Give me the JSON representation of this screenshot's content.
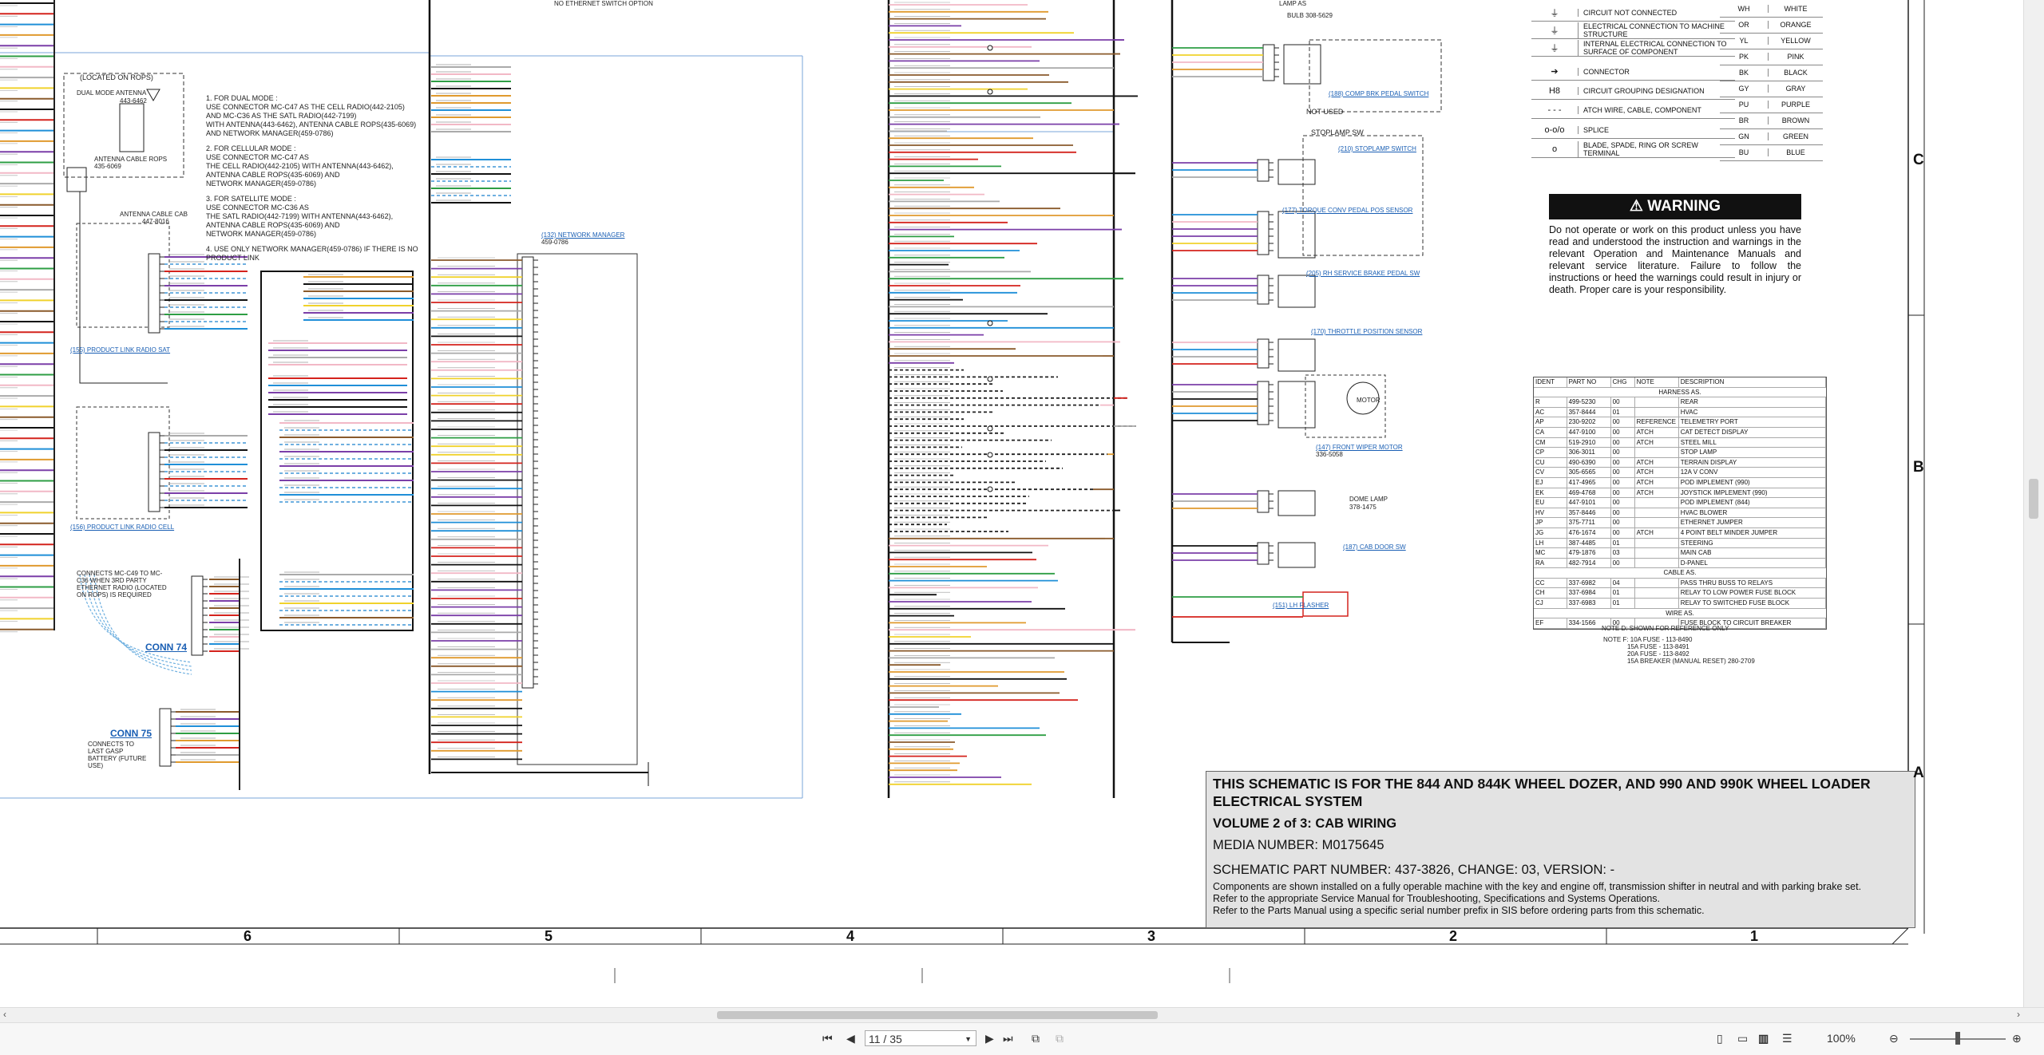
{
  "schematic": {
    "general_notes": [
      "1. FOR DUAL MODE :",
      "USE CONNECTOR MC-C47 AS THE CELL RADIO(442-2105)",
      "AND MC-C36 AS THE SATL RADIO(442-7199)",
      "WITH ANTENNA(443-6462), ANTENNA CABLE ROPS(435-6069)",
      "AND NETWORK MANAGER(459-0786)",
      "2. FOR CELLULAR MODE :",
      "USE CONNECTOR MC-C47 AS",
      "THE CELL RADIO(442-2105) WITH ANTENNA(443-6462),",
      "ANTENNA CABLE ROPS(435-6069) AND",
      "NETWORK MANAGER(459-0786)",
      "3. FOR SATELLITE MODE :",
      "USE CONNECTOR MC-C36 AS",
      "THE SATL RADIO(442-7199) WITH ANTENNA(443-6462),",
      "ANTENNA CABLE ROPS(435-6069) AND",
      "NETWORK MANAGER(459-0786)",
      "4. USE ONLY NETWORK MANAGER(459-0786) IF THERE IS NO",
      "PRODUCT LINK"
    ],
    "rops_label": "(LOCATED ON ROPS)",
    "dual_mode_antenna": "DUAL MODE ANTENNA",
    "antenna_part": "443-6462",
    "antenna_cable_rops": "ANTENNA CABLE ROPS",
    "antenna_cable_rops_part": "435-6069",
    "antenna_cable_cab": "ANTENNA CABLE CAB",
    "antenna_cable_cab_part": "447-8016",
    "link_product_link_sat": "(155) PRODUCT LINK RADIO SAT",
    "link_product_link_cell": "(156) PRODUCT LINK RADIO CELL",
    "link_network_manager": "(132) NETWORK MANAGER",
    "network_manager_part": "459-0786",
    "conn74": "CONN 74",
    "conn75": "CONN 75",
    "conn75_note": "CONNECTS TO LAST GASP BATTERY (FUTURE USE)",
    "mc_c49_note": "CONNECTS MC-C49 TO MC-C36 WHEN 3RD PARTY ETHERNET RADIO (LOCATED ON ROPS) IS REQUIRED",
    "not_used": "NOT USED",
    "stoplamp_sw": "STOPLAMP SW",
    "dome_lamp": "DOME LAMP",
    "dome_lamp_part": "378-1475",
    "motor": "MOTOR",
    "front_wiper_motor": "(147) FRONT WIPER MOTOR",
    "front_wiper_part": "336-5058",
    "throttle_sensor": "(170) THROTTLE POSITION SENSOR",
    "torque_conv_sensor": "(177) TORQUE CONV PEDAL POS SENSOR",
    "service_brake_sensor": "(205) RH SERVICE BRAKE PEDAL SW",
    "stoplamp_switch": "(210) STOPLAMP SWITCH",
    "door_sw": "(187) CAB DOOR SW",
    "flasher": "(151) LH FLASHER",
    "comp_brk_switch": "(188) COMP BRK PEDAL SWITCH",
    "top_cut_text": "NO ETHERNET SWITCH OPTION",
    "lamp_text": "LAMP AS",
    "bulb_text": "BULB 308-5629"
  },
  "legend": {
    "rows": [
      {
        "sym": "⏚",
        "text": "CIRCUIT NOT CONNECTED"
      },
      {
        "sym": "⏚",
        "text": "ELECTRICAL CONNECTION TO MACHINE STRUCTURE"
      },
      {
        "sym": "⏚",
        "text": "INTERNAL ELECTRICAL CONNECTION TO SURFACE OF COMPONENT"
      },
      {
        "sym": "➔",
        "text": "CONNECTOR"
      },
      {
        "sym": "H8",
        "text": "CIRCUIT GROUPING DESIGNATION"
      },
      {
        "sym": "- - -",
        "text": "ATCH WIRE, CABLE, COMPONENT"
      },
      {
        "sym": "o-o/o",
        "text": "SPLICE"
      },
      {
        "sym": "o",
        "text": "BLADE, SPADE, RING OR SCREW TERMINAL"
      }
    ],
    "colors": [
      {
        "code": "WH",
        "name": "WHITE"
      },
      {
        "code": "OR",
        "name": "ORANGE"
      },
      {
        "code": "YL",
        "name": "YELLOW"
      },
      {
        "code": "PK",
        "name": "PINK"
      },
      {
        "code": "BK",
        "name": "BLACK"
      },
      {
        "code": "GY",
        "name": "GRAY"
      },
      {
        "code": "PU",
        "name": "PURPLE"
      },
      {
        "code": "BR",
        "name": "BROWN"
      },
      {
        "code": "GN",
        "name": "GREEN"
      },
      {
        "code": "BU",
        "name": "BLUE"
      }
    ]
  },
  "warning": {
    "heading": "WARNING",
    "text": "Do not operate or work on this product unless you have read and understood the instruction and warnings in the relevant Operation and Maintenance Manuals and relevant service literature. Failure to follow the instructions or heed the warnings could result in injury or death. Proper care is your responsibility."
  },
  "parts_table": {
    "headers": [
      "IDENT",
      "PART NO",
      "CHG",
      "NOTE",
      "DESCRIPTION"
    ],
    "harness_label": "HARNESS AS.",
    "harness_rows": [
      [
        "R",
        "499-5230",
        "00",
        "",
        "REAR"
      ],
      [
        "AC",
        "357-8444",
        "01",
        "",
        "HVAC"
      ],
      [
        "AP",
        "230-9202",
        "00",
        "REFERENCE",
        "TELEMETRY PORT"
      ],
      [
        "CA",
        "447-9100",
        "00",
        "ATCH",
        "CAT DETECT DISPLAY"
      ],
      [
        "CM",
        "519-2910",
        "00",
        "ATCH",
        "STEEL MILL"
      ],
      [
        "CP",
        "306-3011",
        "00",
        "",
        "STOP LAMP"
      ],
      [
        "CU",
        "490-6390",
        "00",
        "ATCH",
        "TERRAIN DISPLAY"
      ],
      [
        "CV",
        "305-6565",
        "00",
        "ATCH",
        "12A V CONV"
      ],
      [
        "EJ",
        "417-4965",
        "00",
        "ATCH",
        "POD IMPLEMENT (990)"
      ],
      [
        "EK",
        "469-4768",
        "00",
        "ATCH",
        "JOYSTICK IMPLEMENT (990)"
      ],
      [
        "EU",
        "447-9101",
        "00",
        "",
        "POD IMPLEMENT (844)"
      ],
      [
        "HV",
        "357-8446",
        "00",
        "",
        "HVAC BLOWER"
      ],
      [
        "JP",
        "375-7711",
        "00",
        "",
        "ETHERNET JUMPER"
      ],
      [
        "JG",
        "476-1674",
        "00",
        "ATCH",
        "4 POINT BELT MINDER JUMPER"
      ],
      [
        "LH",
        "387-4485",
        "01",
        "",
        "STEERING"
      ],
      [
        "MC",
        "479-1876",
        "03",
        "",
        "MAIN CAB"
      ],
      [
        "RA",
        "482-7914",
        "00",
        "",
        "D-PANEL"
      ]
    ],
    "cable_label": "CABLE AS.",
    "cable_rows": [
      [
        "CC",
        "337-6982",
        "04",
        "",
        "PASS THRU BUSS TO RELAYS"
      ],
      [
        "CH",
        "337-6984",
        "01",
        "",
        "RELAY TO LOW POWER FUSE BLOCK"
      ],
      [
        "CJ",
        "337-6983",
        "01",
        "",
        "RELAY TO SWITCHED FUSE BLOCK"
      ]
    ],
    "wire_label": "WIRE AS.",
    "wire_rows": [
      [
        "EF",
        "334-1566",
        "00",
        "",
        "FUSE BLOCK TO CIRCUIT BREAKER"
      ]
    ],
    "note1": "NOTE D: SHOWN FOR REFERENCE ONLY",
    "note2": "NOTE F: 10A FUSE - 113-8490",
    "note3": "15A FUSE - 113-8491",
    "note4": "20A FUSE - 113-8492",
    "note5": "15A BREAKER (MANUAL RESET) 280-2709"
  },
  "title_block": {
    "title": "THIS SCHEMATIC IS FOR THE 844 AND 844K WHEEL DOZER, AND 990 AND 990K WHEEL LOADER ELECTRICAL SYSTEM",
    "volume": "VOLUME 2 of 3: CAB WIRING",
    "media": "MEDIA NUMBER: M0175645",
    "part": "SCHEMATIC PART NUMBER: 437-3826, CHANGE: 03, VERSION: -",
    "notes": [
      "Components are shown installed on a fully operable machine with the key and engine off, transmission shifter in neutral and with parking brake set.",
      "Refer to the appropriate Service Manual for Troubleshooting, Specifications and Systems Operations.",
      "Refer to the Parts Manual using a specific serial number prefix in SIS before ordering parts from this schematic."
    ]
  },
  "zones": {
    "numbers": [
      "6",
      "5",
      "4",
      "3",
      "2",
      "1"
    ],
    "letters": [
      "C",
      "B",
      "A"
    ]
  },
  "viewer": {
    "page": "11 / 35",
    "zoom": "100%",
    "first_page": "⏮",
    "prev_page": "◀",
    "next_page": "▶",
    "last_page": "⏭",
    "zoom_out": "⊖",
    "zoom_in": "⊕",
    "scroll_left": "‹",
    "scroll_right": "›"
  }
}
